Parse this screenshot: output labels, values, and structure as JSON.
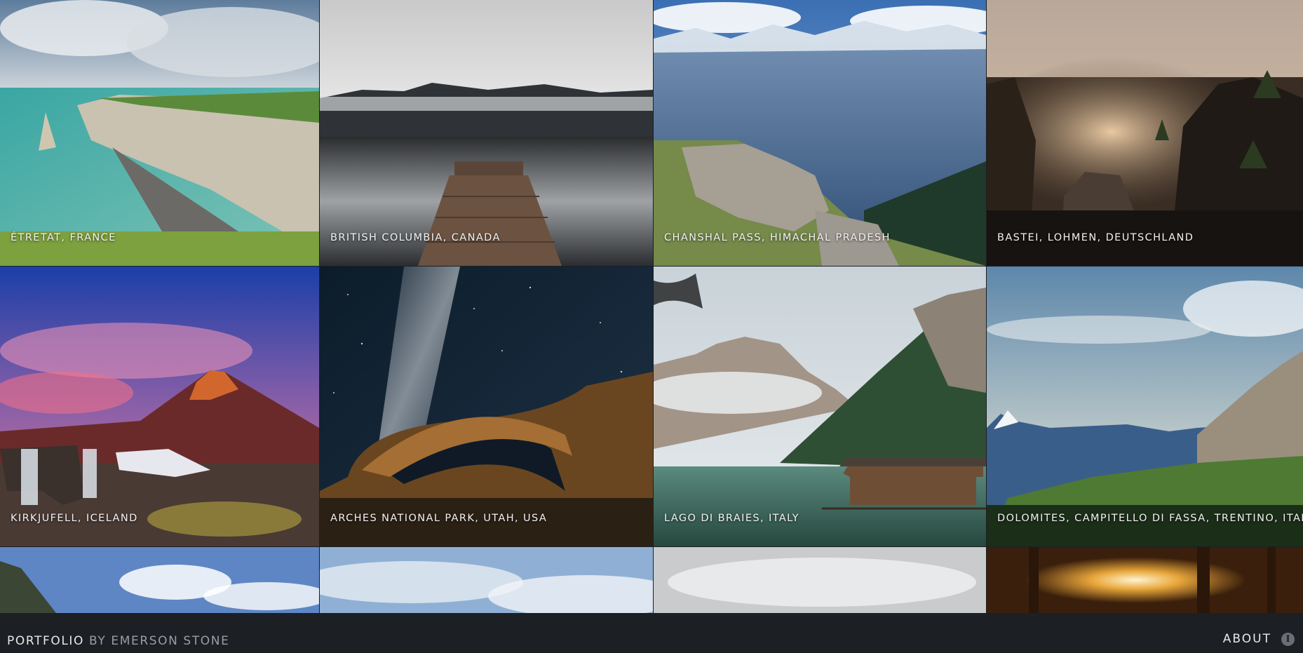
{
  "gallery": {
    "tiles": [
      {
        "caption": "ÉTRETAT, FRANCE"
      },
      {
        "caption": "BRITISH COLUMBIA, CANADA"
      },
      {
        "caption": "CHANSHAL PASS, HIMACHAL PRADESH"
      },
      {
        "caption": "BASTEI, LOHMEN, DEUTSCHLAND"
      },
      {
        "caption": "KIRKJUFELL, ICELAND"
      },
      {
        "caption": "ARCHES NATIONAL PARK, UTAH, USA"
      },
      {
        "caption": "LAGO DI BRAIES, ITALY"
      },
      {
        "caption": "DOLOMITES, CAMPITELLO DI FASSA, TRENTINO, ITALY"
      }
    ]
  },
  "footer": {
    "brand_main": "PORTFOLIO",
    "brand_by": "BY EMERSON STONE",
    "about_label": "ABOUT",
    "about_icon": "info-icon"
  },
  "colors": {
    "footer_bg": "#1c1f24",
    "caption_text": "#f2f2f2",
    "brand_muted": "#9a9ea4"
  }
}
